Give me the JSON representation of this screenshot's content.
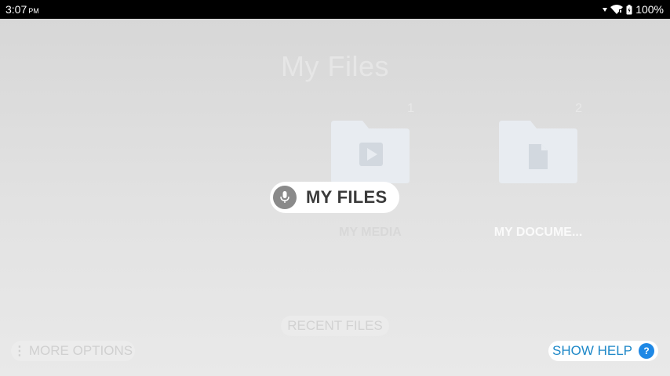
{
  "status_bar": {
    "time": "3:07",
    "ampm": "PM",
    "battery": "100%"
  },
  "title": "My Files",
  "folders": [
    {
      "label": "MY MEDIA",
      "badge": "1",
      "icon": "media-folder-icon"
    },
    {
      "label": "MY DOCUME...",
      "badge": "2",
      "icon": "document-folder-icon"
    }
  ],
  "voice_prompt": {
    "label": "MY FILES",
    "icon": "microphone-icon"
  },
  "buttons": {
    "recent": "RECENT FILES",
    "more_options": "MORE OPTIONS",
    "show_help": "SHOW HELP",
    "help_icon_text": "?"
  },
  "colors": {
    "status_bar_bg": "#000000",
    "help_accent": "#1e88e5",
    "folder": "#e8ecf1"
  }
}
